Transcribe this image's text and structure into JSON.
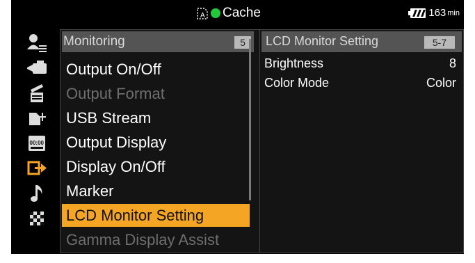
{
  "status_bar": {
    "media_icon": "media-card-icon",
    "record_indicator_color": "#21c93b",
    "label": "Cache",
    "battery_icon": "battery-icon",
    "remaining": "163",
    "remaining_unit": "min"
  },
  "sidebar_icons": [
    "user-menu-icon",
    "camera-settings-icon",
    "clapperboard-icon",
    "media-icon",
    "timecode-icon",
    "output-icon",
    "audio-note-icon",
    "checkerboard-icon"
  ],
  "menu": {
    "title": "Monitoring",
    "page": "5",
    "items": [
      {
        "label": "Output On/Off",
        "state": "enabled"
      },
      {
        "label": "Output Format",
        "state": "disabled"
      },
      {
        "label": "USB Stream",
        "state": "enabled"
      },
      {
        "label": "Output Display",
        "state": "enabled"
      },
      {
        "label": "Display On/Off",
        "state": "enabled"
      },
      {
        "label": "Marker",
        "state": "enabled"
      },
      {
        "label": "LCD Monitor Setting",
        "state": "selected"
      },
      {
        "label": "Gamma Display Assist",
        "state": "disabled"
      }
    ]
  },
  "panel": {
    "title": "LCD Monitor Setting",
    "page": "5-7",
    "settings": [
      {
        "label": "Brightness",
        "value": "8"
      },
      {
        "label": "Color Mode",
        "value": "Color"
      }
    ]
  },
  "colors": {
    "selected_bg": "#f4a523",
    "header_bg": "#545454",
    "active_icon": "#f4a523"
  }
}
